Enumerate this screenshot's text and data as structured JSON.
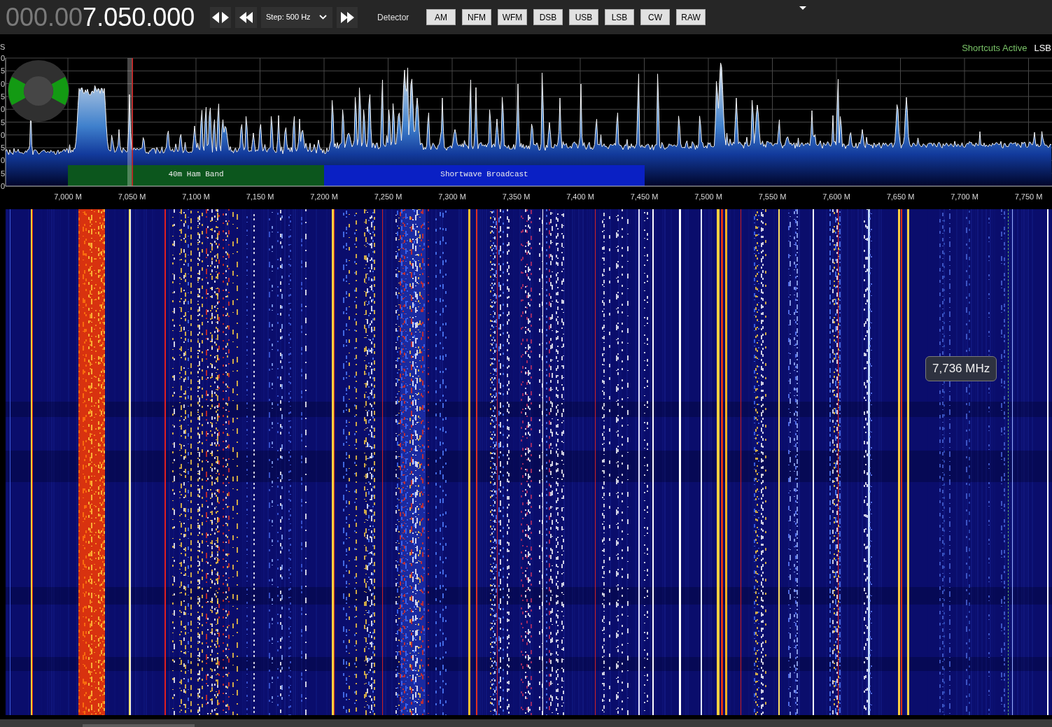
{
  "toolbar": {
    "frequency": {
      "dim_digits": "000.00",
      "digits": "7.050.000"
    },
    "step_select": {
      "value": "Step: 500 Hz"
    },
    "detector_label": "Detector",
    "mode_buttons": [
      "AM",
      "NFM",
      "WFM",
      "DSB",
      "USB",
      "LSB",
      "CW",
      "RAW"
    ]
  },
  "spectrum": {
    "unit_label": "S",
    "shortcuts_status": "Shortcuts Active",
    "current_mode": "LSB",
    "y_axis_labels": [
      "0",
      "5",
      "0",
      "5",
      "0",
      "5",
      "0",
      "5",
      "0",
      "5",
      "0"
    ],
    "x_axis_labels": [
      "7,000 M",
      "7,050 M",
      "7,100 M",
      "7,150 M",
      "7,200 M",
      "7,250 M",
      "7,300 M",
      "7,350 M",
      "7,400 M",
      "7,450 M",
      "7,500 M",
      "7,550 M",
      "7,600 M",
      "7,650 M",
      "7,700 M",
      "7,750 M"
    ],
    "bands": [
      {
        "label": "40m Ham Band",
        "color": "#0c561d"
      },
      {
        "label": "Shortwave Broadcast",
        "color": "#0a20c4"
      }
    ]
  },
  "waterfall": {
    "frequency_tooltip": "7,736 MHz"
  }
}
